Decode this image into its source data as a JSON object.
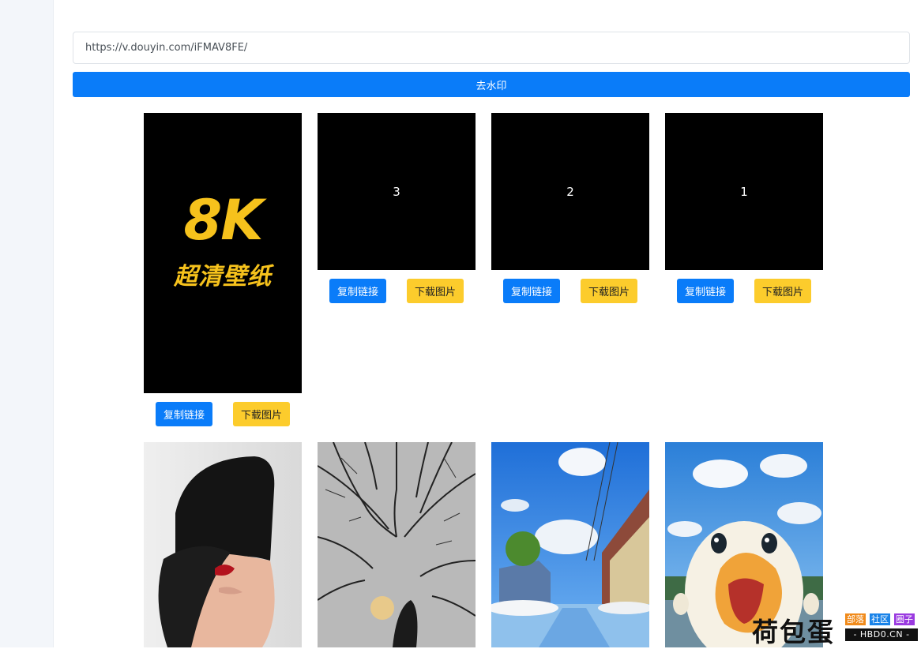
{
  "form": {
    "url_value": "https://v.douyin.com/iFMAV8FE/",
    "submit_label": "去水印"
  },
  "cards": [
    {
      "cover_big": "8K",
      "cover_small": "超清壁纸",
      "copy_label": "复制链接",
      "download_label": "下载图片"
    },
    {
      "number": "3",
      "copy_label": "复制链接",
      "download_label": "下载图片"
    },
    {
      "number": "2",
      "copy_label": "复制链接",
      "download_label": "下载图片"
    },
    {
      "number": "1",
      "copy_label": "复制链接",
      "download_label": "下载图片"
    }
  ],
  "photos": [
    "woman-with-cap",
    "bare-trees-with-moon",
    "sunny-street-puddle",
    "cartoon-duck"
  ],
  "watermark": {
    "main": "荷包蛋",
    "tags": [
      "部落",
      "社区",
      "圈子"
    ],
    "domain": "- HBD0.CN -"
  },
  "colors": {
    "primary": "#0a7cf9",
    "download": "#fccc2c",
    "cover_text": "#f6c21c",
    "tag_orange": "#f08a1a",
    "tag_blue": "#1a83e8",
    "tag_purple": "#9a3ae0"
  }
}
